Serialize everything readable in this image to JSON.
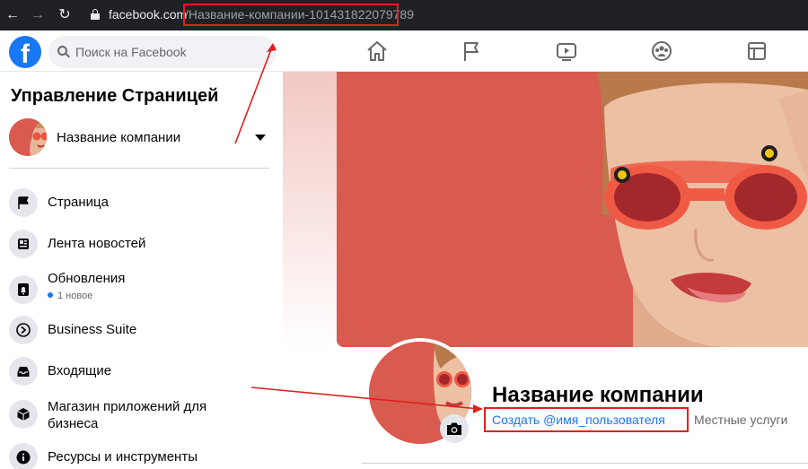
{
  "browser": {
    "host": "facebook.com",
    "path": "/Название-компании-101431822079789"
  },
  "topbar": {
    "logo": "f",
    "search_placeholder": "Поиск на Facebook",
    "nav_icons": [
      "home-icon",
      "flag-icon",
      "watch-icon",
      "groups-icon",
      "gaming-icon"
    ]
  },
  "sidebar": {
    "title": "Управление Страницей",
    "page_name": "Название компании",
    "items": [
      {
        "label": "Страница",
        "icon": "flag-icon"
      },
      {
        "label": "Лента новостей",
        "icon": "news-feed-icon"
      },
      {
        "label": "Обновления",
        "icon": "bell-icon",
        "sub": "1 новое"
      },
      {
        "label": "Business Suite",
        "icon": "business-suite-icon"
      },
      {
        "label": "Входящие",
        "icon": "inbox-icon"
      },
      {
        "label": "Магазин приложений для бизнеса",
        "icon": "app-store-icon"
      },
      {
        "label": "Ресурсы и инструменты",
        "icon": "info-icon"
      }
    ]
  },
  "profile": {
    "name": "Название компании",
    "username_link": "Создать @имя_пользователя",
    "category": "Местные услуги"
  },
  "colors": {
    "brand": "#1877f2",
    "cover": "#d95a4e",
    "annotation": "#e02020"
  }
}
